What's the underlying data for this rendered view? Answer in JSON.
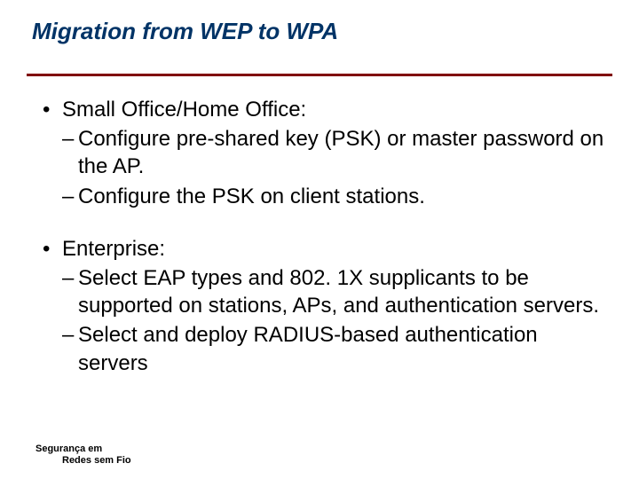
{
  "title": "Migration from WEP to WPA",
  "bullets": [
    {
      "text": "Small Office/Home Office:",
      "sub": [
        "Configure pre-shared key (PSK) or master password on the AP.",
        "Configure the PSK on client stations."
      ]
    },
    {
      "text": "Enterprise:",
      "sub": [
        "Select EAP types and 802. 1X supplicants to be supported on stations, APs, and authentication servers.",
        "Select and deploy RADIUS-based authentication servers"
      ]
    }
  ],
  "footer": {
    "line1": "Segurança em",
    "line2": "Redes sem Fio"
  }
}
